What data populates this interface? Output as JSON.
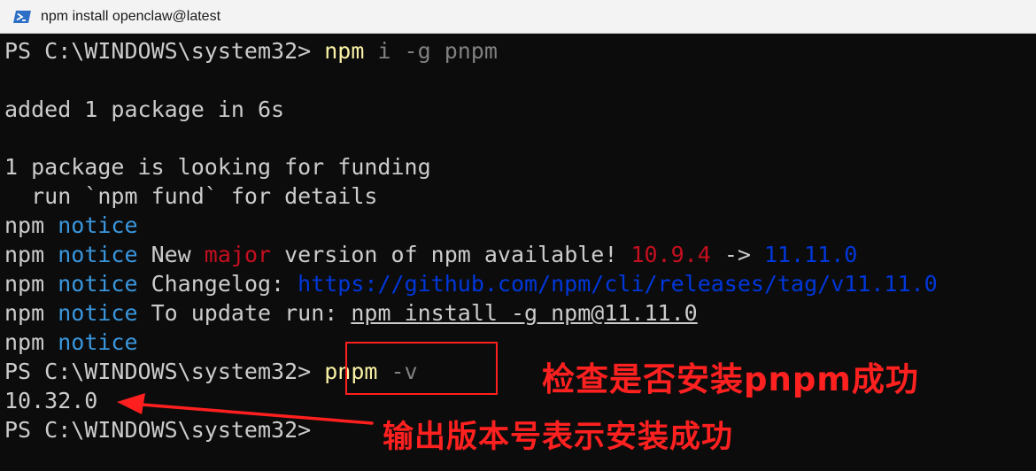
{
  "window": {
    "title": "npm install openclaw@latest",
    "icon": "powershell-icon"
  },
  "terminal": {
    "line1": {
      "prompt": "PS C:\\WINDOWS\\system32> ",
      "cmd": "npm",
      "args": " i -g pnpm"
    },
    "line3": "added 1 package in 6s",
    "line5": "1 package is looking for funding",
    "line6": "  run `npm fund` for details",
    "notice1": {
      "npm": "npm ",
      "notice": "notice"
    },
    "notice2": {
      "npm": "npm ",
      "notice": "notice",
      "text1": " New ",
      "major": "major",
      "text2": " version of npm available! ",
      "old": "10.9.4",
      "arrow": " -> ",
      "new": "11.11.0"
    },
    "notice3": {
      "npm": "npm ",
      "notice": "notice",
      "text": " Changelog: ",
      "link": "https://github.com/npm/cli/releases/tag/v11.11.0"
    },
    "notice4": {
      "npm": "npm ",
      "notice": "notice",
      "text": " To update run: ",
      "cmd": "npm install -g npm@11.11.0"
    },
    "notice5": {
      "npm": "npm ",
      "notice": "notice"
    },
    "line11": {
      "prompt": "PS C:\\WINDOWS\\system32> ",
      "cmd": "pnpm",
      "args": " -v"
    },
    "line12": "10.32.0",
    "line13": {
      "prompt": "PS C:\\WINDOWS\\system32>"
    }
  },
  "annotations": {
    "check": "检查是否安装pnpm成功",
    "result": "输出版本号表示安装成功"
  },
  "colors": {
    "background": "#0c0c0c",
    "text": "#cccccc",
    "command": "#f9f1a5",
    "parameter": "#808080",
    "notice": "#3a96dd",
    "major": "#c50f1f",
    "version": "#0037da",
    "annotation": "#ff2020"
  }
}
